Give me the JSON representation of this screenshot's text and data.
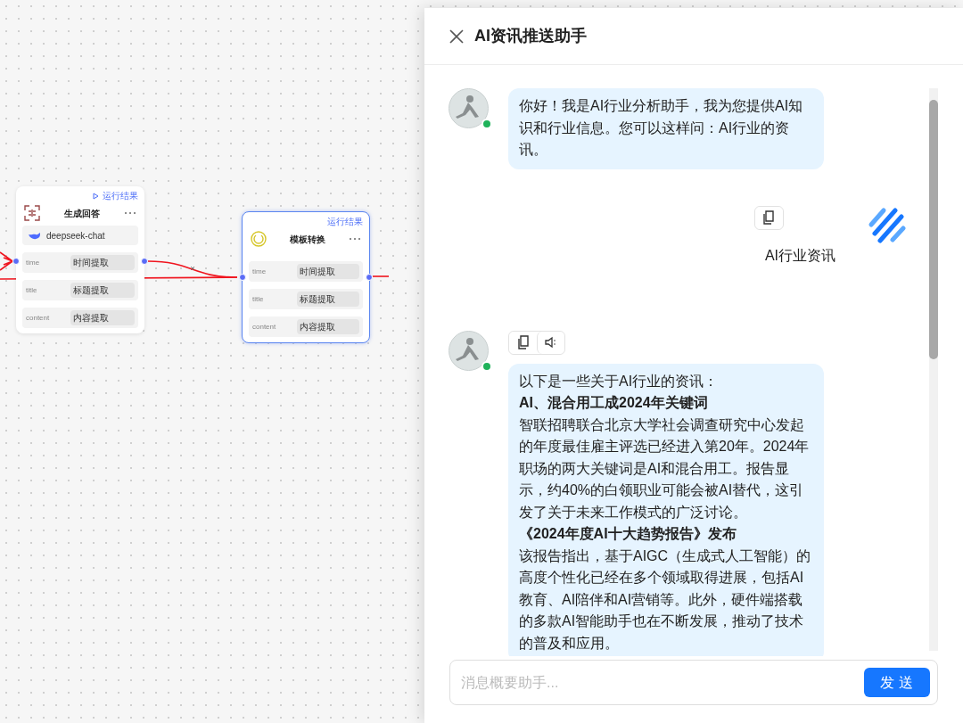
{
  "canvas": {
    "nodes": [
      {
        "kind": "llm",
        "title": "生成回答",
        "run_result": "运行结果",
        "play": true,
        "model": "deepseek-chat",
        "selected": false,
        "fields": [
          {
            "label": "time",
            "value": "时间提取"
          },
          {
            "label": "title",
            "value": "标题提取"
          },
          {
            "label": "content",
            "value": "内容提取"
          }
        ]
      },
      {
        "kind": "template",
        "title": "模板转换",
        "run_result": "运行结果",
        "play": false,
        "selected": true,
        "fields": [
          {
            "label": "time",
            "value": "时间提取"
          },
          {
            "label": "title",
            "value": "标题提取"
          },
          {
            "label": "content",
            "value": "内容提取"
          }
        ]
      }
    ]
  },
  "chat_panel": {
    "title": "AI资讯推送助手",
    "messages": [
      {
        "kind": "assistant",
        "online": true,
        "paragraphs": [
          {
            "kind": "text",
            "text": "你好！我是AI行业分析助手，我为您提供AI知识和行业信息。您可以这样问：AI行业的资讯。"
          }
        ]
      },
      {
        "kind": "user",
        "copy_button": true,
        "paragraphs": [
          {
            "kind": "text",
            "text": "AI行业资讯"
          }
        ]
      },
      {
        "kind": "assistant",
        "online": true,
        "copy_button": true,
        "speak_button": true,
        "paragraphs": [
          {
            "kind": "text",
            "text": "以下是一些关于AI行业的资讯："
          },
          {
            "kind": "heading",
            "text": "AI、混合用工成2024年关键词"
          },
          {
            "kind": "text",
            "text": "智联招聘联合北京大学社会调查研究中心发起的年度最佳雇主评选已经进入第20年。2024年职场的两大关键词是AI和混合用工。报告显示，约40%的白领职业可能会被AI替代，这引发了关于未来工作模式的广泛讨论。"
          },
          {
            "kind": "heading",
            "text": "《2024年度AI十大趋势报告》发布"
          },
          {
            "kind": "text",
            "text": "该报告指出，基于AIGC（生成式人工智能）的高度个性化已经在多个领域取得进展，包括AI教育、AI陪伴和AI营销等。此外，硬件端搭载的多款AI智能助手也在不断发展，推动了技术的普及和应用。"
          }
        ]
      }
    ],
    "input": {
      "placeholder": "消息概要助手..."
    },
    "send_button": "发送"
  }
}
